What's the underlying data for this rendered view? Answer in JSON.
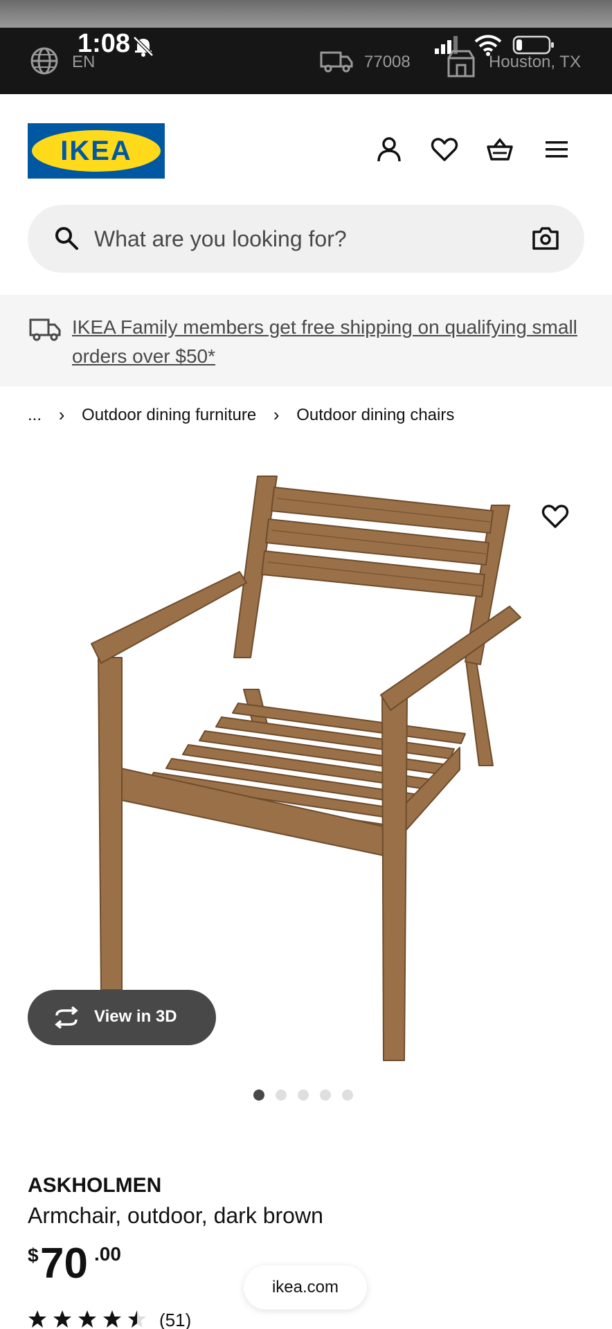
{
  "status_bar": {
    "time": "1:08",
    "language": "EN",
    "zip": "77008",
    "location": "Houston, TX"
  },
  "header": {
    "logo_text": "IKEA",
    "brand_colors": {
      "blue": "#0058a3",
      "yellow": "#ffda1a"
    },
    "icons": [
      "user-icon",
      "heart-icon",
      "basket-icon",
      "menu-icon"
    ]
  },
  "search": {
    "placeholder": "What are you looking for?"
  },
  "promo": {
    "text": "IKEA Family members get free shipping on qualifying small orders over $50*"
  },
  "breadcrumb": {
    "items": [
      "...",
      "Outdoor dining furniture",
      "Outdoor dining chairs"
    ]
  },
  "gallery": {
    "view_3d_label": "View in 3D",
    "image_count": 5,
    "active_index": 0
  },
  "product": {
    "name": "ASKHOLMEN",
    "description": "Armchair, outdoor, dark brown",
    "price_currency": "$",
    "price_integer": "70",
    "price_decimal": ".00",
    "rating_value": 4.5,
    "rating_max": 5,
    "review_count": "(51)"
  },
  "browser": {
    "url": "ikea.com"
  }
}
